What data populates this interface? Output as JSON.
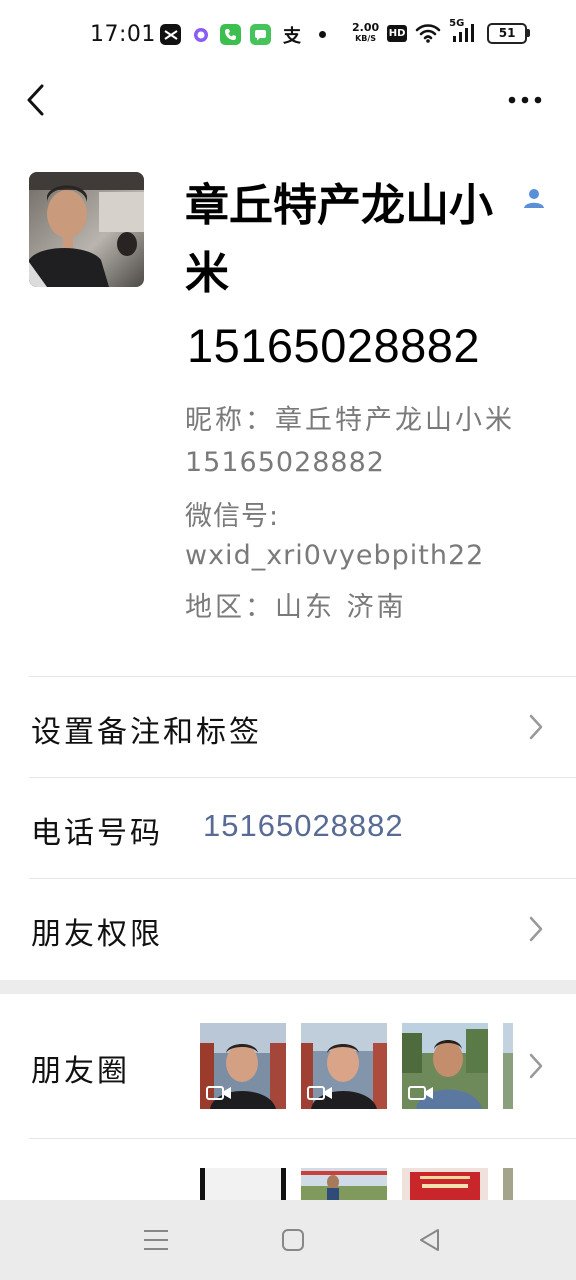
{
  "status_bar": {
    "time": "17:01",
    "zhi_glyph": "支",
    "speed_value": "2.00",
    "speed_unit": "KB/S",
    "hd": "HD",
    "net": "5G",
    "battery": "51"
  },
  "profile": {
    "display_name": "章丘特产龙山小米",
    "phone_title": "15165028882",
    "nickname_line": "昵称：章丘特产龙山小米",
    "nickname_cont": "15165028882",
    "wechat_label": "微信号:",
    "wechat_id": "wxid_xri0vyebpith22",
    "region_line": "地区：山东 济南"
  },
  "rows": {
    "remark_label": "设置备注和标签",
    "phone_label": "电话号码",
    "phone_value": "15165028882",
    "permission_label": "朋友权限",
    "moments_label": "朋友圈"
  },
  "colors": {
    "link": "#576b95",
    "muted": "#7a7a7a",
    "divider": "#e6e6e6"
  },
  "icons": [
    "back-icon",
    "more-icon",
    "contact-badge-icon",
    "chevron-right-icon",
    "video-icon",
    "menu-icon",
    "home-icon",
    "back-nav-icon"
  ]
}
